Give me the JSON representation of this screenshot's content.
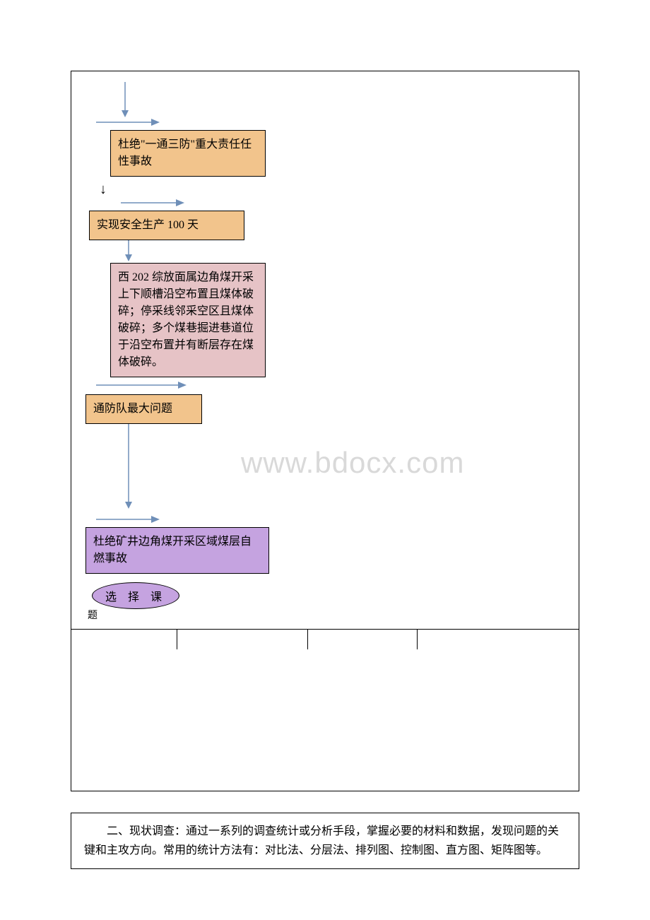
{
  "flowchart": {
    "box1": "杜绝\"一通三防\"重大责任任性事故",
    "box2": "实现安全生产 100 天",
    "box3": "西 202 综放面属边角煤开采上下顺槽沿空布置且煤体破碎；停采线邻采空区且煤体破碎；多个煤巷掘进巷道位于沿空布置并有断层存在煤体破碎。",
    "box4": "通防队最大问题",
    "box5": "杜绝矿井边角煤开采区域煤层自燃事故",
    "oval_line1": "选 择 课",
    "oval_line2": "题"
  },
  "watermark": "www.bdocx.com",
  "section2": {
    "text": "二、现状调查：通过一系列的调查统计或分析手段，掌握必要的材料和数据，发现问题的关键和主攻方向。常用的统计方法有：对比法、分层法、排列图、控制图、直方图、矩阵图等。"
  }
}
